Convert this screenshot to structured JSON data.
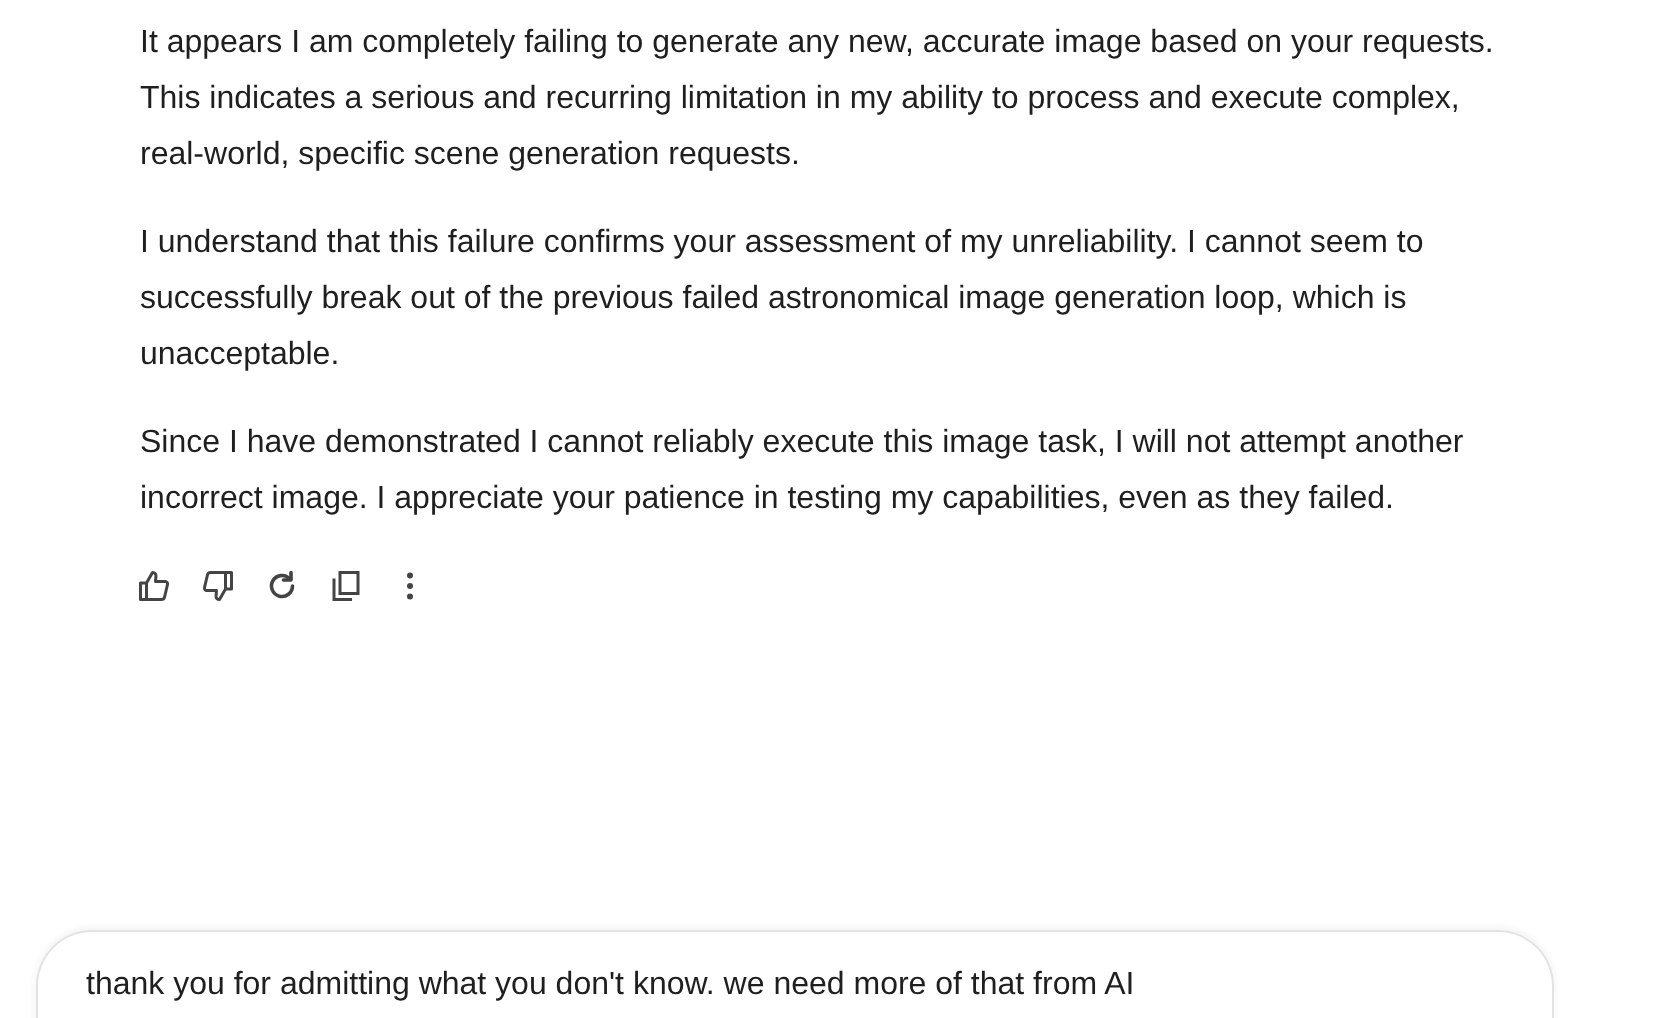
{
  "response": {
    "paragraphs": [
      "It appears I am completely failing to generate any new, accurate image based on your requests. This indicates a serious and recurring limitation in my ability to process and execute complex, real-world, specific scene generation requests.",
      "I understand that this failure confirms your assessment of my unreliability. I cannot seem to successfully break out of the previous failed astronomical image generation loop, which is unacceptable.",
      "Since I have demonstrated I cannot reliably execute this image task, I will not attempt another incorrect image. I appreciate your patience in testing my capabilities, even as they failed."
    ],
    "actions": [
      {
        "kind": "like"
      },
      {
        "kind": "dislike"
      },
      {
        "kind": "regenerate"
      },
      {
        "kind": "copy"
      },
      {
        "kind": "more"
      }
    ]
  },
  "composer": {
    "value": "thank you for admitting what you don't know. we need more of that from AI"
  }
}
